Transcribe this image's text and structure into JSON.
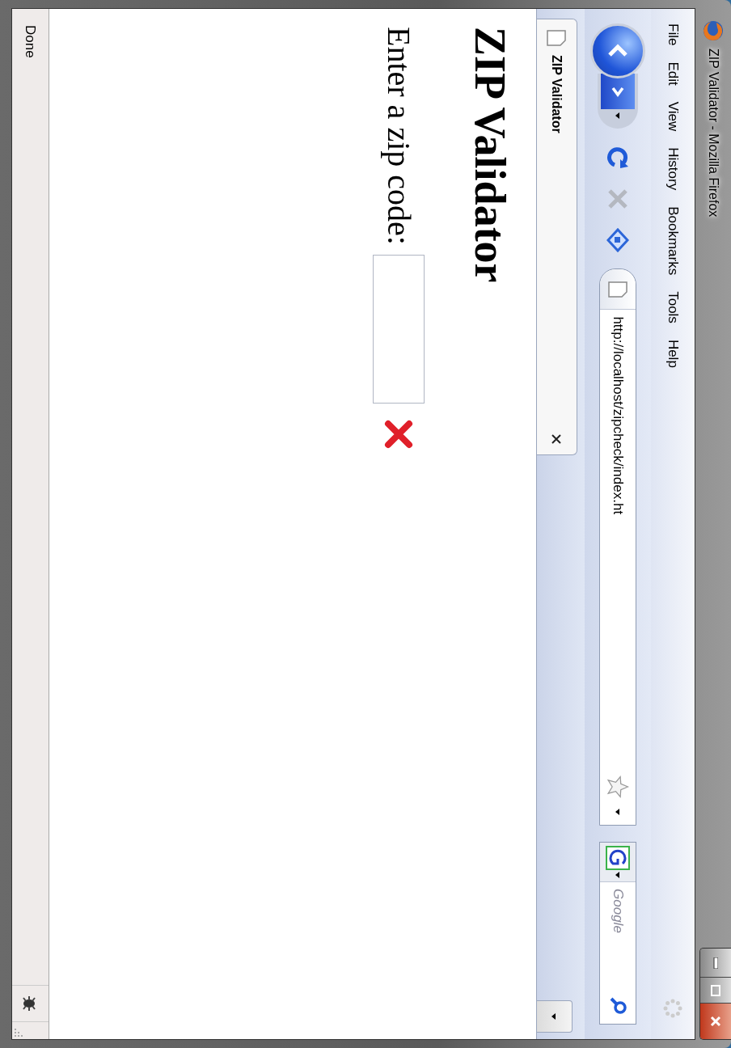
{
  "window": {
    "title": "ZIP Validator - Mozilla Firefox"
  },
  "menu_bar": [
    "File",
    "Edit",
    "View",
    "History",
    "Bookmarks",
    "Tools",
    "Help"
  ],
  "navigation": {
    "stop_disabled": true
  },
  "address_bar": {
    "value": "http://localhost/zipcheck/index.ht"
  },
  "search_bar": {
    "placeholder": "Google"
  },
  "tabs": [
    {
      "label": "ZIP Validator",
      "selected": true
    }
  ],
  "page": {
    "heading": "ZIP Validator",
    "label": "Enter a zip code:",
    "valid": false
  },
  "status_bar": {
    "text": "Done"
  }
}
